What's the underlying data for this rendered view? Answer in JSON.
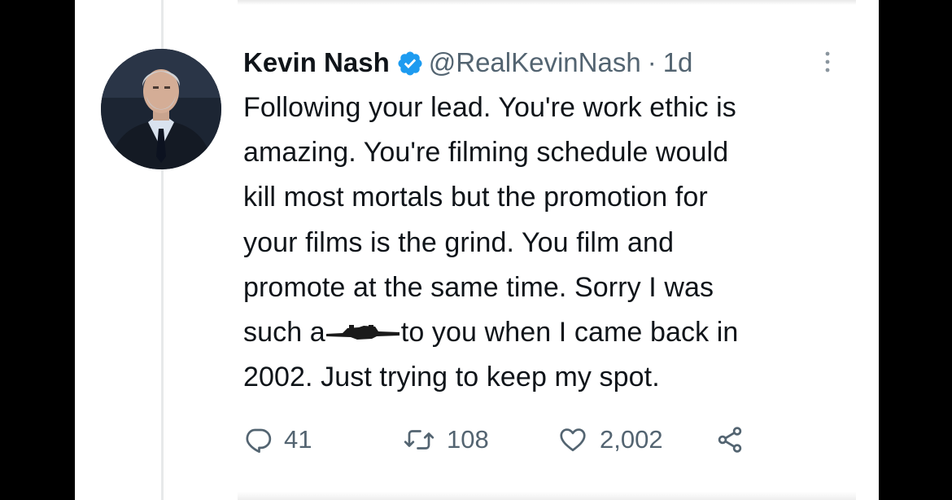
{
  "tweet": {
    "author": {
      "display_name": "Kevin Nash",
      "handle": "@RealKevinNash",
      "verified": true,
      "avatar_icon": "profile-photo"
    },
    "separator": "·",
    "timestamp": "1d",
    "text_lines": [
      "Following your lead. You're work ethic is",
      "amazing. You're filming schedule would",
      "kill most mortals but the promotion for",
      "your films is the grind. You film and",
      "promote at the same time. Sorry I was",
      "such a",
      "to you when I came back in",
      "2002. Just trying to keep  my spot."
    ],
    "actions": {
      "replies": "41",
      "retweets": "108",
      "likes": "2,002"
    }
  },
  "colors": {
    "verified_blue": "#1d9bf0",
    "text_primary": "#0f1419",
    "text_secondary": "#536471",
    "frame": "#000000"
  },
  "icons": {
    "verified": "verified-badge-icon",
    "more": "more-vertical-icon",
    "reply": "reply-icon",
    "retweet": "retweet-icon",
    "like": "heart-icon",
    "share": "share-icon"
  }
}
